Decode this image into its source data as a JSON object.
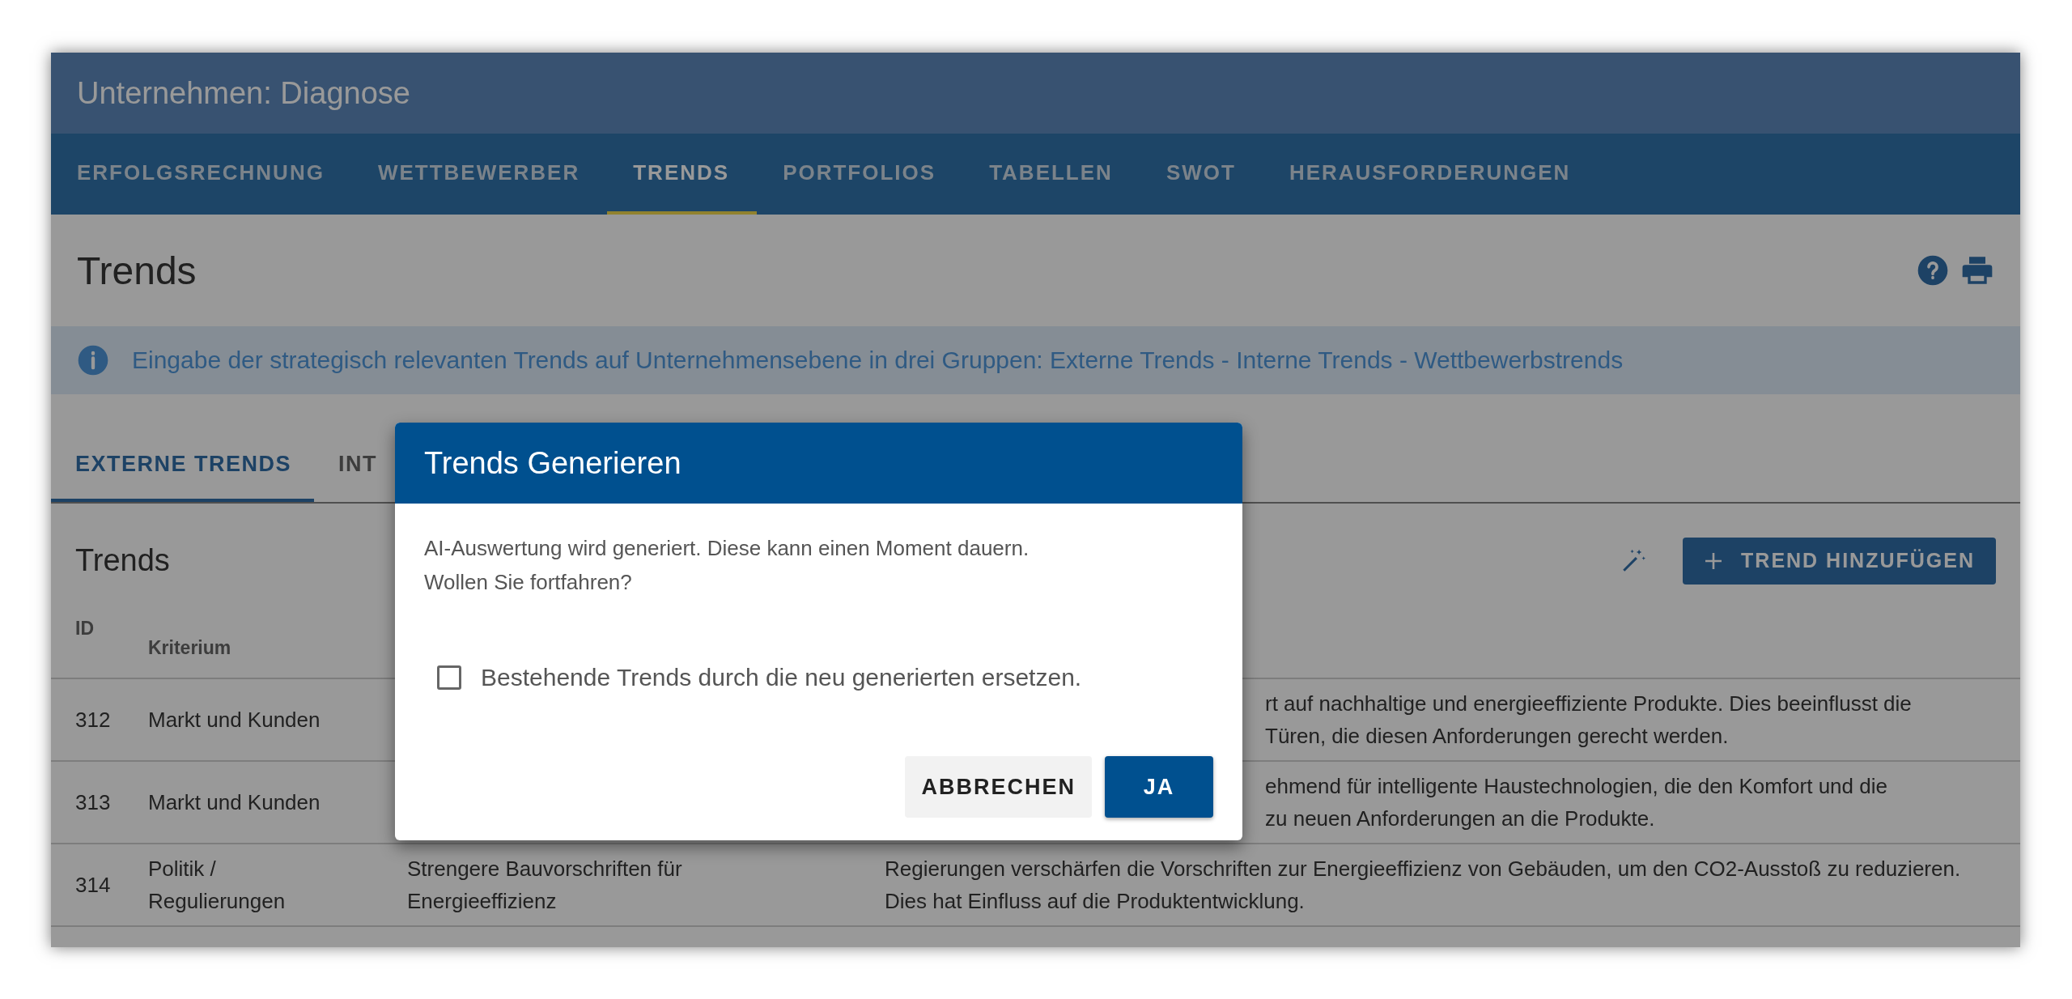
{
  "window": {
    "title": "Unternehmen: Diagnose"
  },
  "tabs": [
    {
      "label": "ERFOLGSRECHNUNG",
      "selected": false
    },
    {
      "label": "WETTBEWERBER",
      "selected": false
    },
    {
      "label": "TRENDS",
      "selected": true
    },
    {
      "label": "PORTFOLIOS",
      "selected": false
    },
    {
      "label": "TABELLEN",
      "selected": false
    },
    {
      "label": "SWOT",
      "selected": false
    },
    {
      "label": "HERAUSFORDERUNGEN",
      "selected": false
    }
  ],
  "page_title": "Trends",
  "info": "Eingabe der strategisch relevanten Trends auf Unternehmensebene in drei Gruppen: Externe Trends - Interne Trends - Wettbewerbstrends",
  "sub_tabs": [
    {
      "label": "EXTERNE TRENDS",
      "selected": true
    },
    {
      "label": "INT",
      "selected": false
    }
  ],
  "section": {
    "title": "Trends",
    "add_button": "TREND HINZUFÜGEN"
  },
  "table": {
    "columns": [
      "ID",
      "Kriterium"
    ],
    "rows": [
      {
        "kind": "covered",
        "id": "312",
        "criterion": "Markt und Kunden",
        "description": [
          "rt auf nachhaltige und energieeffiziente Produkte. Dies beeinflusst die",
          "Türen, die diesen Anforderungen gerecht werden."
        ]
      },
      {
        "kind": "covered",
        "id": "313",
        "criterion": "Markt und Kunden",
        "description": [
          "ehmend für intelligente Haustechnologien, die den Komfort und die",
          "zu neuen Anforderungen an die Produkte."
        ]
      },
      {
        "kind": "full",
        "id": "314",
        "criterion": "Politik / Regulierungen",
        "title": "Strengere Bauvorschriften für Energieeffizienz",
        "description": [
          "Regierungen verschärfen die Vorschriften zur Energieeffizienz von Gebäuden, um den CO2-Ausstoß zu reduzieren. Dies hat Einfluss auf die Produktentwicklung."
        ]
      }
    ]
  },
  "dialog": {
    "title": "Trends Generieren",
    "message": [
      "AI-Auswertung wird generiert. Diese kann einen Moment dauern.",
      "Wollen Sie fortfahren?"
    ],
    "checkbox": {
      "label": "Bestehende Trends durch die neu generierten ersetzen.",
      "checked": false
    },
    "buttons": [
      "ABBRECHEN",
      "JA"
    ]
  }
}
